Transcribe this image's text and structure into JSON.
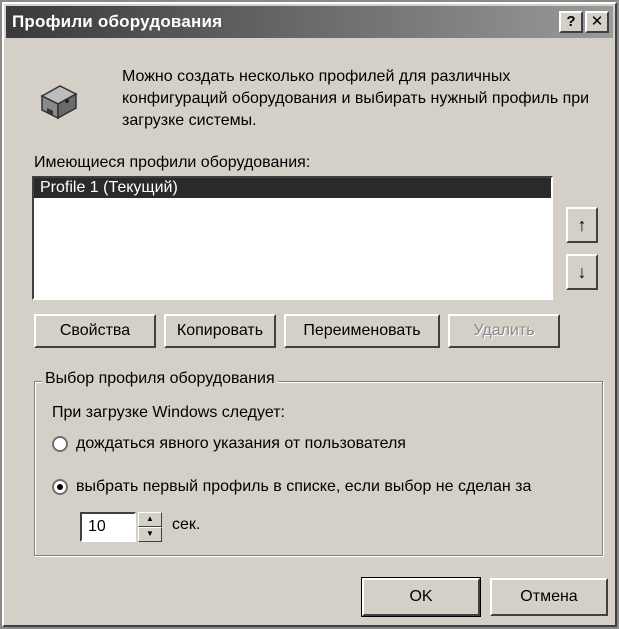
{
  "window": {
    "title": "Профили оборудования",
    "help_glyph": "?",
    "close_glyph": "✕"
  },
  "intro": {
    "text": "Можно создать несколько профилей для различных конфигураций оборудования и выбирать нужный профиль при загрузке системы.",
    "icon": "hardware-icon"
  },
  "profiles": {
    "label": "Имеющиеся профили оборудования:",
    "items": [
      {
        "label": "Profile 1 (Текущий)",
        "selected": true
      }
    ],
    "move_up_glyph": "↑",
    "move_down_glyph": "↓"
  },
  "actions": {
    "properties": "Свойства",
    "copy": "Копировать",
    "rename": "Переименовать",
    "delete": "Удалить",
    "delete_enabled": false
  },
  "selection": {
    "group_title": "Выбор профиля оборудования",
    "prompt": "При загрузке Windows следует:",
    "option_wait": "дождаться явного указания от пользователя",
    "option_first": "выбрать первый профиль в списке, если выбор не сделан за",
    "selected_option": "option_first",
    "seconds_value": "10",
    "seconds_unit": "сек."
  },
  "footer": {
    "ok": "OK",
    "cancel": "Отмена"
  },
  "colors": {
    "dialog_face": "#d4d0c8",
    "selection": "#2a2a2a"
  }
}
